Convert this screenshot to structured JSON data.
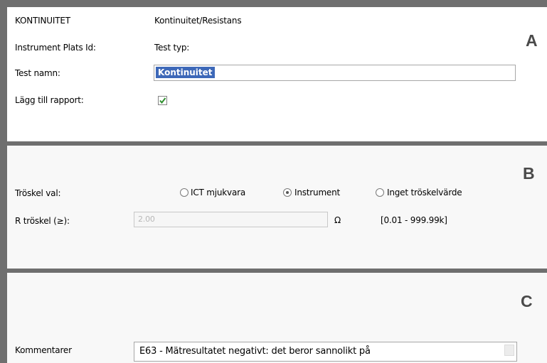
{
  "panel_a": {
    "letter": "A",
    "rows": {
      "title_label": "KONTINUITET",
      "title_value": "Kontinuitet/Resistans",
      "instrument_label": "Instrument Plats Id:",
      "test_type_label": "Test typ:",
      "test_name_label": "Test namn:",
      "test_name_value": "Kontinuitet",
      "add_report_label": "Lägg till rapport:",
      "add_report_checked": true
    }
  },
  "panel_b": {
    "letter": "B",
    "threshold_label": "Tröskel val:",
    "options": [
      {
        "label": "ICT mjukvara",
        "selected": false
      },
      {
        "label": "Instrument",
        "selected": true
      },
      {
        "label": "Inget tröskelvärde",
        "selected": false
      }
    ],
    "r_threshold_label": "R tröskel (≥):",
    "r_threshold_value": "2.00",
    "unit": "Ω",
    "range": "[0.01 - 999.99k]"
  },
  "panel_c": {
    "letter": "C",
    "comments_label": "Kommentarer",
    "comments_value": "E63 - Mätresultatet negativt: det beror sannolikt på"
  },
  "colors": {
    "separator": "#6f6f6f",
    "selection": "#3d68b8",
    "checkmark": "#2f8f2f",
    "corner_letter": "#4a4a4a"
  }
}
